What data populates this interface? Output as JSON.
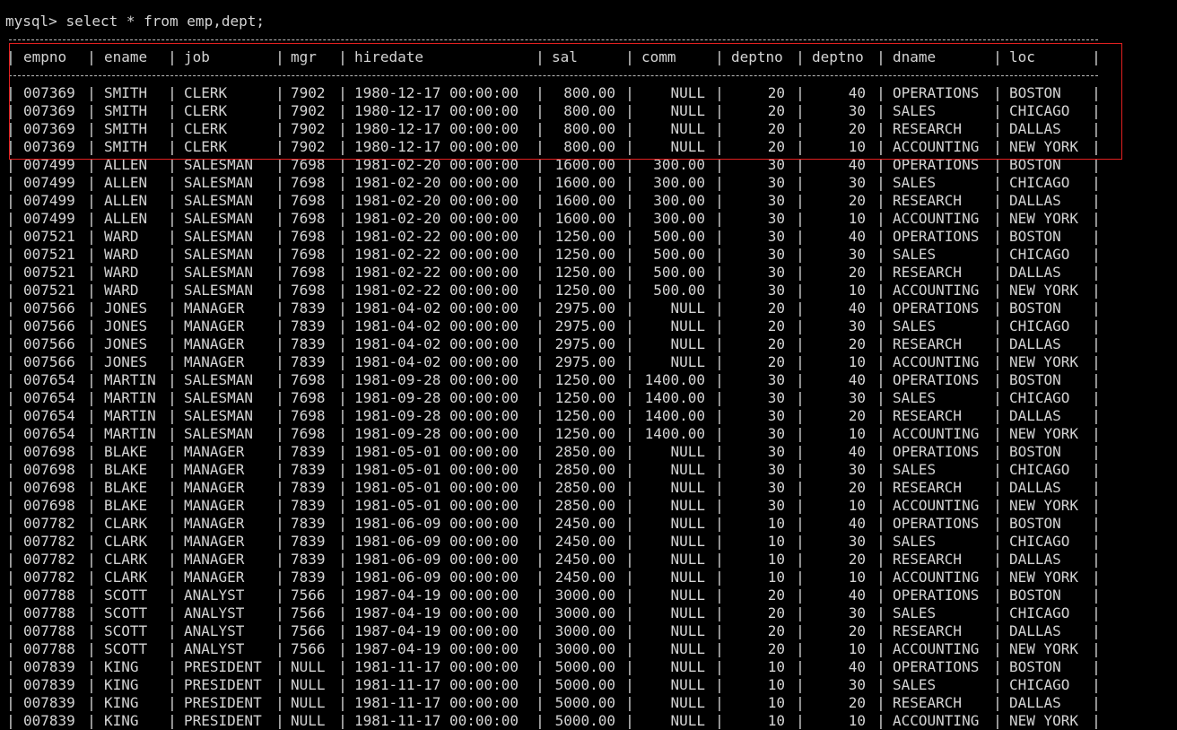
{
  "terminal": {
    "prompt": "mysql>",
    "command": "select * from emp,dept;",
    "highlight_color": "#e02020"
  },
  "table": {
    "columns": [
      "empno",
      "ename",
      "job",
      "mgr",
      "hiredate",
      "sal",
      "comm",
      "deptno",
      "deptno",
      "dname",
      "loc"
    ],
    "rows": [
      [
        "007369",
        "SMITH",
        "CLERK",
        "7902",
        "1980-12-17 00:00:00",
        "800.00",
        "NULL",
        "20",
        "40",
        "OPERATIONS",
        "BOSTON"
      ],
      [
        "007369",
        "SMITH",
        "CLERK",
        "7902",
        "1980-12-17 00:00:00",
        "800.00",
        "NULL",
        "20",
        "30",
        "SALES",
        "CHICAGO"
      ],
      [
        "007369",
        "SMITH",
        "CLERK",
        "7902",
        "1980-12-17 00:00:00",
        "800.00",
        "NULL",
        "20",
        "20",
        "RESEARCH",
        "DALLAS"
      ],
      [
        "007369",
        "SMITH",
        "CLERK",
        "7902",
        "1980-12-17 00:00:00",
        "800.00",
        "NULL",
        "20",
        "10",
        "ACCOUNTING",
        "NEW YORK"
      ],
      [
        "007499",
        "ALLEN",
        "SALESMAN",
        "7698",
        "1981-02-20 00:00:00",
        "1600.00",
        "300.00",
        "30",
        "40",
        "OPERATIONS",
        "BOSTON"
      ],
      [
        "007499",
        "ALLEN",
        "SALESMAN",
        "7698",
        "1981-02-20 00:00:00",
        "1600.00",
        "300.00",
        "30",
        "30",
        "SALES",
        "CHICAGO"
      ],
      [
        "007499",
        "ALLEN",
        "SALESMAN",
        "7698",
        "1981-02-20 00:00:00",
        "1600.00",
        "300.00",
        "30",
        "20",
        "RESEARCH",
        "DALLAS"
      ],
      [
        "007499",
        "ALLEN",
        "SALESMAN",
        "7698",
        "1981-02-20 00:00:00",
        "1600.00",
        "300.00",
        "30",
        "10",
        "ACCOUNTING",
        "NEW YORK"
      ],
      [
        "007521",
        "WARD",
        "SALESMAN",
        "7698",
        "1981-02-22 00:00:00",
        "1250.00",
        "500.00",
        "30",
        "40",
        "OPERATIONS",
        "BOSTON"
      ],
      [
        "007521",
        "WARD",
        "SALESMAN",
        "7698",
        "1981-02-22 00:00:00",
        "1250.00",
        "500.00",
        "30",
        "30",
        "SALES",
        "CHICAGO"
      ],
      [
        "007521",
        "WARD",
        "SALESMAN",
        "7698",
        "1981-02-22 00:00:00",
        "1250.00",
        "500.00",
        "30",
        "20",
        "RESEARCH",
        "DALLAS"
      ],
      [
        "007521",
        "WARD",
        "SALESMAN",
        "7698",
        "1981-02-22 00:00:00",
        "1250.00",
        "500.00",
        "30",
        "10",
        "ACCOUNTING",
        "NEW YORK"
      ],
      [
        "007566",
        "JONES",
        "MANAGER",
        "7839",
        "1981-04-02 00:00:00",
        "2975.00",
        "NULL",
        "20",
        "40",
        "OPERATIONS",
        "BOSTON"
      ],
      [
        "007566",
        "JONES",
        "MANAGER",
        "7839",
        "1981-04-02 00:00:00",
        "2975.00",
        "NULL",
        "20",
        "30",
        "SALES",
        "CHICAGO"
      ],
      [
        "007566",
        "JONES",
        "MANAGER",
        "7839",
        "1981-04-02 00:00:00",
        "2975.00",
        "NULL",
        "20",
        "20",
        "RESEARCH",
        "DALLAS"
      ],
      [
        "007566",
        "JONES",
        "MANAGER",
        "7839",
        "1981-04-02 00:00:00",
        "2975.00",
        "NULL",
        "20",
        "10",
        "ACCOUNTING",
        "NEW YORK"
      ],
      [
        "007654",
        "MARTIN",
        "SALESMAN",
        "7698",
        "1981-09-28 00:00:00",
        "1250.00",
        "1400.00",
        "30",
        "40",
        "OPERATIONS",
        "BOSTON"
      ],
      [
        "007654",
        "MARTIN",
        "SALESMAN",
        "7698",
        "1981-09-28 00:00:00",
        "1250.00",
        "1400.00",
        "30",
        "30",
        "SALES",
        "CHICAGO"
      ],
      [
        "007654",
        "MARTIN",
        "SALESMAN",
        "7698",
        "1981-09-28 00:00:00",
        "1250.00",
        "1400.00",
        "30",
        "20",
        "RESEARCH",
        "DALLAS"
      ],
      [
        "007654",
        "MARTIN",
        "SALESMAN",
        "7698",
        "1981-09-28 00:00:00",
        "1250.00",
        "1400.00",
        "30",
        "10",
        "ACCOUNTING",
        "NEW YORK"
      ],
      [
        "007698",
        "BLAKE",
        "MANAGER",
        "7839",
        "1981-05-01 00:00:00",
        "2850.00",
        "NULL",
        "30",
        "40",
        "OPERATIONS",
        "BOSTON"
      ],
      [
        "007698",
        "BLAKE",
        "MANAGER",
        "7839",
        "1981-05-01 00:00:00",
        "2850.00",
        "NULL",
        "30",
        "30",
        "SALES",
        "CHICAGO"
      ],
      [
        "007698",
        "BLAKE",
        "MANAGER",
        "7839",
        "1981-05-01 00:00:00",
        "2850.00",
        "NULL",
        "30",
        "20",
        "RESEARCH",
        "DALLAS"
      ],
      [
        "007698",
        "BLAKE",
        "MANAGER",
        "7839",
        "1981-05-01 00:00:00",
        "2850.00",
        "NULL",
        "30",
        "10",
        "ACCOUNTING",
        "NEW YORK"
      ],
      [
        "007782",
        "CLARK",
        "MANAGER",
        "7839",
        "1981-06-09 00:00:00",
        "2450.00",
        "NULL",
        "10",
        "40",
        "OPERATIONS",
        "BOSTON"
      ],
      [
        "007782",
        "CLARK",
        "MANAGER",
        "7839",
        "1981-06-09 00:00:00",
        "2450.00",
        "NULL",
        "10",
        "30",
        "SALES",
        "CHICAGO"
      ],
      [
        "007782",
        "CLARK",
        "MANAGER",
        "7839",
        "1981-06-09 00:00:00",
        "2450.00",
        "NULL",
        "10",
        "20",
        "RESEARCH",
        "DALLAS"
      ],
      [
        "007782",
        "CLARK",
        "MANAGER",
        "7839",
        "1981-06-09 00:00:00",
        "2450.00",
        "NULL",
        "10",
        "10",
        "ACCOUNTING",
        "NEW YORK"
      ],
      [
        "007788",
        "SCOTT",
        "ANALYST",
        "7566",
        "1987-04-19 00:00:00",
        "3000.00",
        "NULL",
        "20",
        "40",
        "OPERATIONS",
        "BOSTON"
      ],
      [
        "007788",
        "SCOTT",
        "ANALYST",
        "7566",
        "1987-04-19 00:00:00",
        "3000.00",
        "NULL",
        "20",
        "30",
        "SALES",
        "CHICAGO"
      ],
      [
        "007788",
        "SCOTT",
        "ANALYST",
        "7566",
        "1987-04-19 00:00:00",
        "3000.00",
        "NULL",
        "20",
        "20",
        "RESEARCH",
        "DALLAS"
      ],
      [
        "007788",
        "SCOTT",
        "ANALYST",
        "7566",
        "1987-04-19 00:00:00",
        "3000.00",
        "NULL",
        "20",
        "10",
        "ACCOUNTING",
        "NEW YORK"
      ],
      [
        "007839",
        "KING",
        "PRESIDENT",
        "NULL",
        "1981-11-17 00:00:00",
        "5000.00",
        "NULL",
        "10",
        "40",
        "OPERATIONS",
        "BOSTON"
      ],
      [
        "007839",
        "KING",
        "PRESIDENT",
        "NULL",
        "1981-11-17 00:00:00",
        "5000.00",
        "NULL",
        "10",
        "30",
        "SALES",
        "CHICAGO"
      ],
      [
        "007839",
        "KING",
        "PRESIDENT",
        "NULL",
        "1981-11-17 00:00:00",
        "5000.00",
        "NULL",
        "10",
        "20",
        "RESEARCH",
        "DALLAS"
      ],
      [
        "007839",
        "KING",
        "PRESIDENT",
        "NULL",
        "1981-11-17 00:00:00",
        "5000.00",
        "NULL",
        "10",
        "10",
        "ACCOUNTING",
        "NEW YORK"
      ]
    ]
  }
}
